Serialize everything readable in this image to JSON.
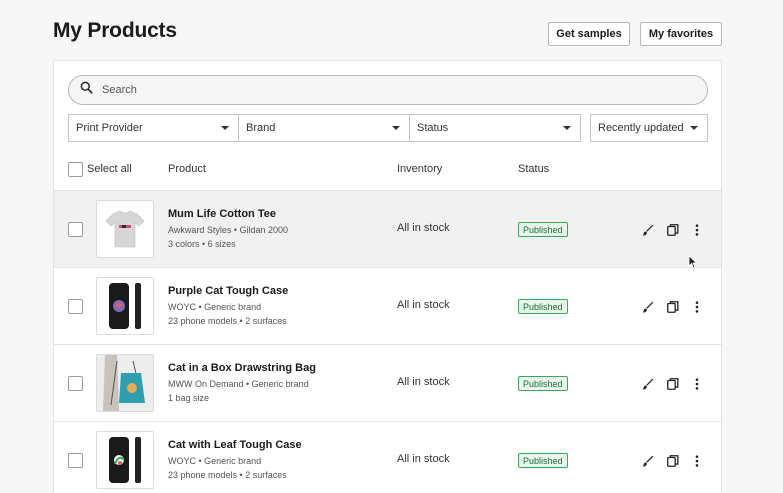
{
  "header": {
    "title": "My Products",
    "get_samples_label": "Get samples",
    "favorites_label": "My favorites"
  },
  "search": {
    "placeholder": "Search",
    "value": ""
  },
  "filters": [
    {
      "label": "Print Provider"
    },
    {
      "label": "Brand"
    },
    {
      "label": "Status"
    },
    {
      "label": "Recently updated"
    }
  ],
  "table": {
    "select_all_label": "Select all",
    "columns": [
      "Product",
      "Inventory",
      "Status"
    ]
  },
  "products": [
    {
      "name": "Mum Life Cotton Tee",
      "meta": "Awkward Styles • Gildan 2000",
      "meta2": "3 colors • 6 sizes",
      "inventory": "All in stock",
      "status": "Published"
    },
    {
      "name": "Purple Cat Tough Case",
      "meta": "WOYC • Generic brand",
      "meta2": "23 phone models • 2 surfaces",
      "inventory": "All in stock",
      "status": "Published"
    },
    {
      "name": "Cat in a Box Drawstring Bag",
      "meta": "MWW On Demand • Generic brand",
      "meta2": "1 bag size",
      "inventory": "All in stock",
      "status": "Published"
    },
    {
      "name": "Cat with Leaf Tough Case",
      "meta": "WOYC • Generic brand",
      "meta2": "23 phone models • 2 surfaces",
      "inventory": "All in stock",
      "status": "Published"
    }
  ],
  "colors": {
    "accent_green": "#3aa857",
    "badge_bg": "#e8f6ec",
    "row_highlight": "#f1f1f1"
  },
  "icons": [
    "search-icon",
    "caret-down-icon",
    "edit-brush-icon",
    "copy-icon",
    "more-vertical-icon",
    "mouse-cursor-icon"
  ]
}
